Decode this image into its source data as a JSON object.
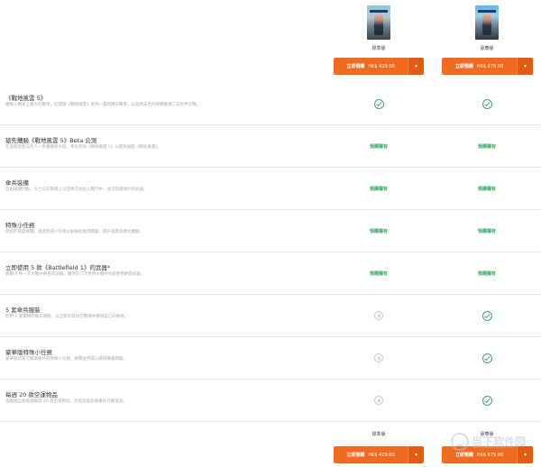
{
  "editions": [
    {
      "name": "標準版",
      "buy": {
        "pre": "立即預購",
        "price": "HK$ 429.00"
      }
    },
    {
      "name": "豪華版",
      "buy": {
        "pre": "立即預購",
        "price": "HK$ 679.00"
      }
    }
  ],
  "rows": [
    {
      "title": "《戰地風雲 5》",
      "desc": "體驗人類史上最大的戰爭，在開發《戰地風雲》系列一貫的精彩戰爭，以前所未見的視覺重現二次世界大戰。",
      "std": "check",
      "dlx": "check"
    },
    {
      "title": "搶先體驗《戰地風雲 5》Beta 公測",
      "desc": "在遊戲發售前先人一步體驗新內容，率先參與《戰地風雲 5》公開測試版《戰地風雲》。",
      "std": "預購獨有",
      "dlx": "預購獨有"
    },
    {
      "title": "傘兵裝備",
      "desc": "自由展開行動，令士兵在戰場上以空降方式投入戰鬥中，並可裝備額外的武器。",
      "std": "預購獨有",
      "dlx": "預購獨有"
    },
    {
      "title": "特殊小任務",
      "desc": "從新的角度挑戰，透過完成小任務以解鎖並獲得獎勵，提升遊戲多樣化體驗。",
      "std": "預購獨有",
      "dlx": "預購獨有"
    },
    {
      "title": "立即使用 5 款《Battlefield 1》的武器*",
      "desc": "解鎖 5 件一次大戰中著名的武器，讓你在二次世界大戰中也能使用經典武器。",
      "std": "預購獨有",
      "dlx": "預購獨有"
    },
    {
      "title": "5 套傘兵服裝",
      "desc": "利用 5 套獨特的傘兵服裝，以全新的裝扮在戰場中展現自己的風格。",
      "std": "cross",
      "dlx": "check"
    },
    {
      "title": "豪華版特殊小任務",
      "desc": "豪華版玩家可解鎖額外的特殊小任務，挑戰並完成以獲得專屬獎勵。",
      "std": "cross",
      "dlx": "check"
    },
    {
      "title": "每週 20 款空運物品",
      "desc": "遊戲推出後每週獲得 20 款空運物品，包括武器及裝備的外觀道具。",
      "std": "cross",
      "dlx": "check"
    }
  ],
  "watermark": {
    "text": "当下软件园",
    "sub": "www.downxia.com"
  }
}
